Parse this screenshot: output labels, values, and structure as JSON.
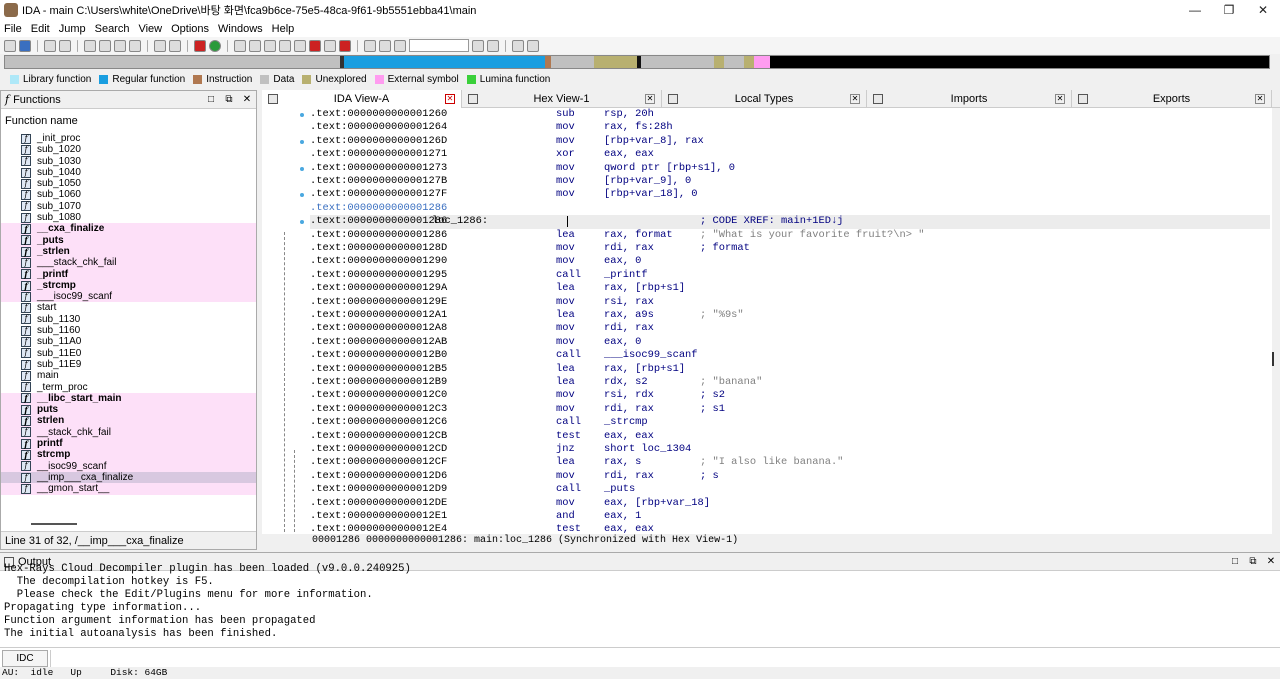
{
  "window": {
    "title": "IDA - main C:\\Users\\white\\OneDrive\\바탕 화면\\fca9b6ce-75e5-48ca-9f61-9b5551ebba41\\main"
  },
  "menu": [
    "File",
    "Edit",
    "Jump",
    "Search",
    "View",
    "Options",
    "Windows",
    "Help"
  ],
  "legend": [
    {
      "label": "Library function",
      "color": "#aee8f8"
    },
    {
      "label": "Regular function",
      "color": "#1a9ee0"
    },
    {
      "label": "Instruction",
      "color": "#b07850"
    },
    {
      "label": "Data",
      "color": "#c0c0c0"
    },
    {
      "label": "Unexplored",
      "color": "#b8b070"
    },
    {
      "label": "External symbol",
      "color": "#ff9cf0"
    },
    {
      "label": "Lumina function",
      "color": "#3ad03a"
    }
  ],
  "functions_panel": {
    "title": "Functions",
    "column": "Function name",
    "status": "Line 31 of 32, /__imp___cxa_finalize",
    "items": [
      {
        "name": "_init_proc",
        "type": "reg"
      },
      {
        "name": "sub_1020",
        "type": "reg"
      },
      {
        "name": "sub_1030",
        "type": "reg"
      },
      {
        "name": "sub_1040",
        "type": "reg"
      },
      {
        "name": "sub_1050",
        "type": "reg"
      },
      {
        "name": "sub_1060",
        "type": "reg"
      },
      {
        "name": "sub_1070",
        "type": "reg"
      },
      {
        "name": "sub_1080",
        "type": "reg"
      },
      {
        "name": "__cxa_finalize",
        "type": "lib"
      },
      {
        "name": "_puts",
        "type": "lib"
      },
      {
        "name": "_strlen",
        "type": "lib"
      },
      {
        "name": "___stack_chk_fail",
        "type": "ext"
      },
      {
        "name": "_printf",
        "type": "lib"
      },
      {
        "name": "_strcmp",
        "type": "lib"
      },
      {
        "name": "___isoc99_scanf",
        "type": "ext"
      },
      {
        "name": "start",
        "type": "reg"
      },
      {
        "name": "sub_1130",
        "type": "reg"
      },
      {
        "name": "sub_1160",
        "type": "reg"
      },
      {
        "name": "sub_11A0",
        "type": "reg"
      },
      {
        "name": "sub_11E0",
        "type": "reg"
      },
      {
        "name": "sub_11E9",
        "type": "reg"
      },
      {
        "name": "main",
        "type": "reg"
      },
      {
        "name": "_term_proc",
        "type": "reg"
      },
      {
        "name": "__libc_start_main",
        "type": "lib"
      },
      {
        "name": "puts",
        "type": "lib"
      },
      {
        "name": "strlen",
        "type": "lib"
      },
      {
        "name": "__stack_chk_fail",
        "type": "ext"
      },
      {
        "name": "printf",
        "type": "lib"
      },
      {
        "name": "strcmp",
        "type": "lib"
      },
      {
        "name": "__isoc99_scanf",
        "type": "ext"
      },
      {
        "name": "__imp___cxa_finalize",
        "type": "sel"
      },
      {
        "name": "__gmon_start__",
        "type": "ext"
      }
    ]
  },
  "tabs": [
    {
      "label": "IDA View-A",
      "active": true
    },
    {
      "label": "Hex View-1"
    },
    {
      "label": "Local Types"
    },
    {
      "label": "Imports"
    },
    {
      "label": "Exports"
    }
  ],
  "disasm": [
    {
      "addr": ".text:0000000000001260",
      "mn": "sub",
      "op": "rsp, 20h"
    },
    {
      "addr": ".text:0000000000001264",
      "mn": "mov",
      "op": "rax, fs:28h"
    },
    {
      "addr": ".text:000000000000126D",
      "mn": "mov",
      "op": "[rbp+var_8], rax"
    },
    {
      "addr": ".text:0000000000001271",
      "mn": "xor",
      "op": "eax, eax"
    },
    {
      "addr": ".text:0000000000001273",
      "mn": "mov",
      "op": "qword ptr [rbp+s1], 0"
    },
    {
      "addr": ".text:000000000000127B",
      "mn": "mov",
      "op": "[rbp+var_9], 0"
    },
    {
      "addr": ".text:000000000000127F",
      "mn": "mov",
      "op": "[rbp+var_18], 0"
    },
    {
      "addr": ".text:0000000000001286",
      "mn": "",
      "op": "",
      "cont": true
    },
    {
      "addr": ".text:0000000000001286",
      "label": "loc_1286:",
      "xref": "; CODE XREF: main+1ED↓j",
      "cur": true
    },
    {
      "addr": ".text:0000000000001286",
      "mn": "lea",
      "op": "rax, format",
      "cm": "; \"What is your favorite fruit?\\n> \""
    },
    {
      "addr": ".text:000000000000128D",
      "mn": "mov",
      "op": "rdi, rax",
      "cm": "; format"
    },
    {
      "addr": ".text:0000000000001290",
      "mn": "mov",
      "op": "eax, 0"
    },
    {
      "addr": ".text:0000000000001295",
      "mn": "call",
      "op": "_printf"
    },
    {
      "addr": ".text:000000000000129A",
      "mn": "lea",
      "op": "rax, [rbp+s1]"
    },
    {
      "addr": ".text:000000000000129E",
      "mn": "mov",
      "op": "rsi, rax"
    },
    {
      "addr": ".text:00000000000012A1",
      "mn": "lea",
      "op": "rax, a9s",
      "cm": "; \"%9s\""
    },
    {
      "addr": ".text:00000000000012A8",
      "mn": "mov",
      "op": "rdi, rax"
    },
    {
      "addr": ".text:00000000000012AB",
      "mn": "mov",
      "op": "eax, 0"
    },
    {
      "addr": ".text:00000000000012B0",
      "mn": "call",
      "op": "___isoc99_scanf"
    },
    {
      "addr": ".text:00000000000012B5",
      "mn": "lea",
      "op": "rax, [rbp+s1]"
    },
    {
      "addr": ".text:00000000000012B9",
      "mn": "lea",
      "op": "rdx, s2",
      "cm": "; \"banana\""
    },
    {
      "addr": ".text:00000000000012C0",
      "mn": "mov",
      "op": "rsi, rdx",
      "cm": "; s2"
    },
    {
      "addr": ".text:00000000000012C3",
      "mn": "mov",
      "op": "rdi, rax",
      "cm": "; s1"
    },
    {
      "addr": ".text:00000000000012C6",
      "mn": "call",
      "op": "_strcmp"
    },
    {
      "addr": ".text:00000000000012CB",
      "mn": "test",
      "op": "eax, eax"
    },
    {
      "addr": ".text:00000000000012CD",
      "mn": "jnz",
      "op": "short loc_1304"
    },
    {
      "addr": ".text:00000000000012CF",
      "mn": "lea",
      "op": "rax, s",
      "cm": "; \"I also like banana.\""
    },
    {
      "addr": ".text:00000000000012D6",
      "mn": "mov",
      "op": "rdi, rax",
      "cm": "; s"
    },
    {
      "addr": ".text:00000000000012D9",
      "mn": "call",
      "op": "_puts"
    },
    {
      "addr": ".text:00000000000012DE",
      "mn": "mov",
      "op": "eax, [rbp+var_18]"
    },
    {
      "addr": ".text:00000000000012E1",
      "mn": "and",
      "op": "eax, 1"
    },
    {
      "addr": ".text:00000000000012E4",
      "mn": "test",
      "op": "eax, eax"
    }
  ],
  "disasm_status": "00001286 0000000000001286: main:loc_1286 (Synchronized with Hex View-1)",
  "output": {
    "title": "Output",
    "lines": [
      "Hex-Rays Cloud Decompiler plugin has been loaded (v9.0.0.240925)",
      "  The decompilation hotkey is F5.",
      "  Please check the Edit/Plugins menu for more information.",
      "Propagating type information...",
      "Function argument information has been propagated",
      "The initial autoanalysis has been finished."
    ],
    "idc_label": "IDC"
  },
  "statusbar": "AU:  idle   Up     Disk: 64GB"
}
